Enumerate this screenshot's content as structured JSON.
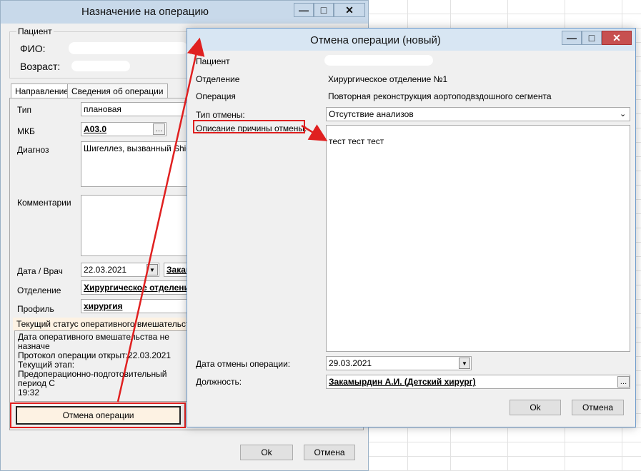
{
  "main_window": {
    "title": "Назначение на операцию",
    "controls": {
      "minimize": "—",
      "maximize": "□",
      "close": "✕"
    },
    "patient_group": {
      "legend": "Пациент",
      "fio_label": "ФИО:",
      "age_label": "Возраст:"
    },
    "tabs": [
      "Направление",
      "Сведения об операции"
    ],
    "form": {
      "type_label": "Тип",
      "type_value": "плановая",
      "mkb_label": "МКБ",
      "mkb_value": "A03.0",
      "diagnosis_label": "Диагноз",
      "diagnosis_value": "Шигеллез, вызванный Shigel",
      "comments_label": "Комментарии",
      "date_doctor_label": "Дата / Врач",
      "date_value": "22.03.2021",
      "doctor_value": "Закам",
      "department_label": "Отделение",
      "department_value": "Хирургическое отделени",
      "profile_label": "Профиль",
      "profile_value": "хирургия"
    },
    "status": {
      "header": "Текущий статус оперативного вмешательства",
      "lines": [
        "Дата оперативного вмешательства не назначе",
        "Протокол операции открыт:22.03.2021",
        "Текущий этап:",
        "Предоперационно-подготовительный период С",
        "19:32"
      ]
    },
    "cancel_operation_button": "Отмена операции",
    "ok_button": "Ok",
    "cancel_button": "Отмена"
  },
  "cancel_window": {
    "title": "Отмена операции (новый)",
    "controls": {
      "minimize": "—",
      "maximize": "□",
      "close": "✕"
    },
    "patient_label": "Пациент",
    "department_label": "Отделение",
    "department_value": "Хирургическое отделение №1",
    "operation_label": "Операция",
    "operation_value": "Повторная реконструкция аортоподвздошного сегмента",
    "cancel_type_label": "Тип отмены:",
    "cancel_type_value": "Отсутствие анализов",
    "reason_label": "Описание причины отмены:",
    "reason_value": "тест тест тест",
    "cancel_date_label": "Дата отмены операции:",
    "cancel_date_value": "29.03.2021",
    "position_label": "Должность:",
    "position_value": "Закамырдин А.И. (Детский хирург)",
    "ok_button": "Ok",
    "cancel_button": "Отмена"
  },
  "colors": {
    "highlight": "#e02020",
    "titlebar": "#c8d9ea",
    "close_button": "#c75050"
  }
}
